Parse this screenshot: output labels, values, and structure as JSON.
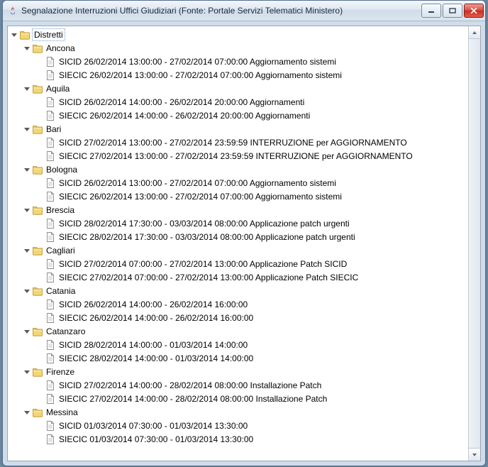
{
  "window": {
    "title": "Segnalazione Interruzioni Uffici Giudiziari (Fonte: Portale Servizi Telematici Ministero)"
  },
  "root_label": "Distretti",
  "districts": [
    {
      "name": "Ancona",
      "entries": [
        "SICID 26/02/2014 13:00:00 - 27/02/2014 07:00:00  Aggiornamento sistemi",
        "SIECIC 26/02/2014 13:00:00 - 27/02/2014 07:00:00  Aggiornamento sistemi"
      ]
    },
    {
      "name": "Aquila",
      "entries": [
        "SICID 26/02/2014 14:00:00 - 26/02/2014 20:00:00  Aggiornamenti",
        "SIECIC 26/02/2014 14:00:00 - 26/02/2014 20:00:00  Aggiornamenti"
      ]
    },
    {
      "name": "Bari",
      "entries": [
        "SICID 27/02/2014 13:00:00 - 27/02/2014 23:59:59  INTERRUZIONE per AGGIORNAMENTO",
        "SIECIC 27/02/2014 13:00:00 - 27/02/2014 23:59:59  INTERRUZIONE per AGGIORNAMENTO"
      ]
    },
    {
      "name": "Bologna",
      "entries": [
        "SICID 26/02/2014 13:00:00 - 27/02/2014 07:00:00  Aggiornamento sistemi",
        "SIECIC 26/02/2014 13:00:00 - 27/02/2014 07:00:00  Aggiornamento sistemi"
      ]
    },
    {
      "name": "Brescia",
      "entries": [
        "SICID 28/02/2014 17:30:00 - 03/03/2014 08:00:00  Applicazione patch urgenti",
        "SIECIC 28/02/2014 17:30:00 - 03/03/2014 08:00:00  Applicazione patch urgenti"
      ]
    },
    {
      "name": "Cagliari",
      "entries": [
        "SICID 27/02/2014 07:00:00 - 27/02/2014 13:00:00  Applicazione Patch SICID",
        "SIECIC 27/02/2014 07:00:00 - 27/02/2014 13:00:00  Applicazione Patch SIECIC"
      ]
    },
    {
      "name": "Catania",
      "entries": [
        "SICID 26/02/2014 14:00:00 - 26/02/2014 16:00:00",
        "SIECIC 26/02/2014 14:00:00 - 26/02/2014 16:00:00"
      ]
    },
    {
      "name": "Catanzaro",
      "entries": [
        "SICID 28/02/2014 14:00:00 - 01/03/2014 14:00:00",
        "SIECIC 28/02/2014 14:00:00 - 01/03/2014 14:00:00"
      ]
    },
    {
      "name": "Firenze",
      "entries": [
        "SICID 27/02/2014 14:00:00 - 28/02/2014 08:00:00  Installazione Patch",
        "SIECIC 27/02/2014 14:00:00 - 28/02/2014 08:00:00  Installazione Patch"
      ]
    },
    {
      "name": "Messina",
      "entries": [
        "SICID 01/03/2014 07:30:00 - 01/03/2014 13:30:00",
        "SIECIC 01/03/2014 07:30:00 - 01/03/2014 13:30:00"
      ]
    }
  ]
}
